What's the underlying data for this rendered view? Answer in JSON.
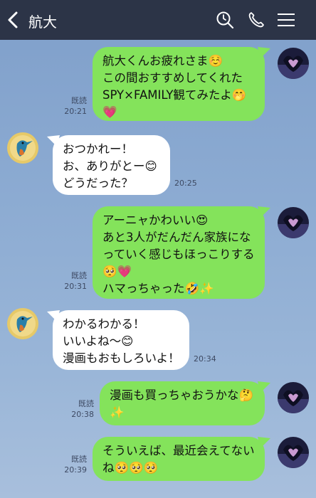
{
  "header": {
    "title": "航大"
  },
  "messages": [
    {
      "side": "mine",
      "lines": [
        "航大くんお疲れさま☺️",
        "この間おすすめしてくれた",
        "SPY×FAMILY観てみたよ🤭",
        "💗"
      ],
      "read": "既読",
      "time": "20:21"
    },
    {
      "side": "theirs",
      "lines": [
        "おつかれー！",
        "お、ありがとー😊",
        "どうだった？"
      ],
      "time": "20:25"
    },
    {
      "side": "mine",
      "lines": [
        "アーニャかわいい😍",
        "あと3人がだんだん家族にな",
        "っていく感じもほっこりする",
        "🥺💗",
        "ハマっちゃった🤣✨"
      ],
      "read": "既読",
      "time": "20:31"
    },
    {
      "side": "theirs",
      "lines": [
        "わかるわかる！",
        "いいよね〜😊",
        "漫画もおもしろいよ！"
      ],
      "time": "20:34"
    },
    {
      "side": "mine",
      "lines": [
        "漫画も買っちゃおうかな🤔",
        "✨"
      ],
      "read": "既読",
      "time": "20:38"
    },
    {
      "side": "mine",
      "lines": [
        "そういえば、最近会えてない",
        "ね🥺🥺🥺"
      ],
      "read": "既読",
      "time": "20:39"
    }
  ]
}
